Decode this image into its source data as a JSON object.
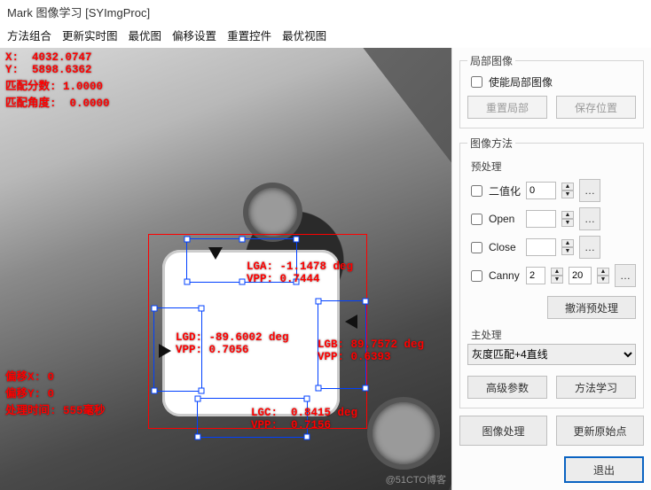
{
  "window": {
    "title": "Mark  图像学习  [SYImgProc]"
  },
  "menu": [
    "方法组合",
    "更新实时图",
    "最优图",
    "偏移设置",
    "重置控件",
    "最优视图"
  ],
  "overlay": {
    "topLeft": "X:  4032.0747\nY:  5898.6362\n匹配分数: 1.0000\n匹配角度:  0.0000",
    "bottomLeft": "偏移X: 0\n偏移Y: 0\n处理时间: 555毫秒",
    "lga": "LGA: -1.1478 deg\nVPP: 0.7444",
    "lgd": "LGD: -89.6002 deg\nVPP: 0.7056",
    "lgb": "LGB: 89.7572 deg\nVPP: 0.6393",
    "lgc": "LGC:  0.8415 deg\nVPP:  0.7156"
  },
  "watermark": "@51CTO博客",
  "panel": {
    "local": {
      "legend": "局部图像",
      "enable": "使能局部图像",
      "reset": "重置局部",
      "save": "保存位置"
    },
    "method": {
      "legend": "图像方法",
      "preLabel": "预处理",
      "items": [
        {
          "name": "二值化",
          "v": "0"
        },
        {
          "name": "Open",
          "v": ""
        },
        {
          "name": "Close",
          "v": ""
        },
        {
          "name": "Canny",
          "v1": "2",
          "v2": "20"
        }
      ],
      "undoPre": "撤消预处理",
      "mainLabel": "主处理",
      "combo": "灰度匹配+4直线",
      "adv": "高级参数",
      "learn": "方法学习"
    },
    "processBtn": "图像处理",
    "updateBtn": "更新原始点",
    "exitBtn": "退出"
  }
}
